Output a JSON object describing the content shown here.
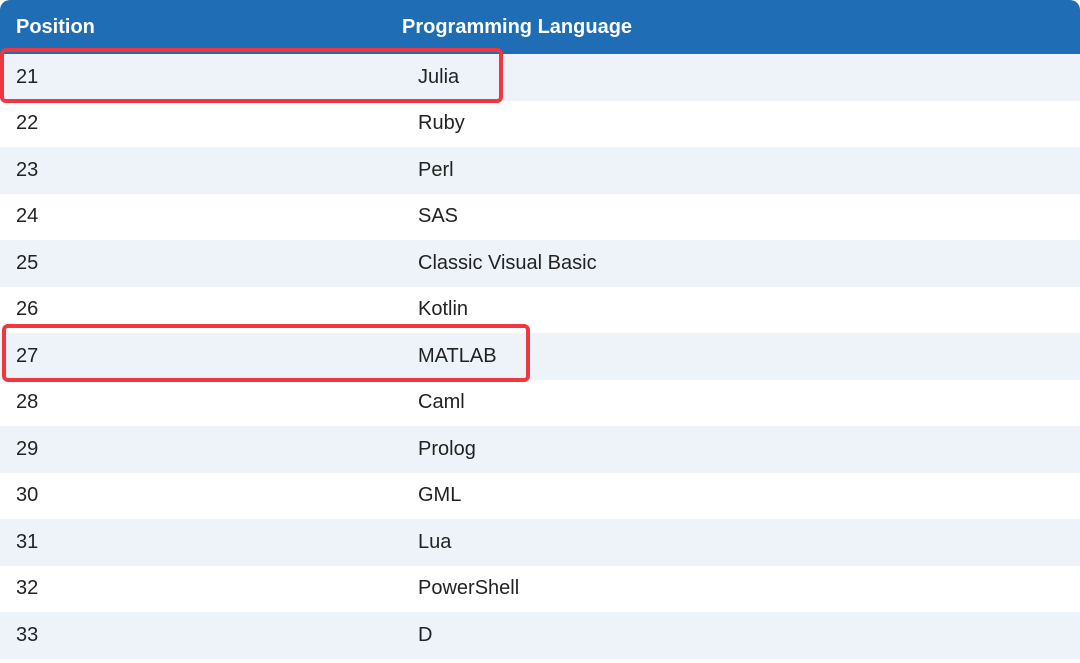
{
  "table": {
    "headers": {
      "position": "Position",
      "language": "Programming Language"
    },
    "rows": [
      {
        "position": "21",
        "language": "Julia"
      },
      {
        "position": "22",
        "language": "Ruby"
      },
      {
        "position": "23",
        "language": "Perl"
      },
      {
        "position": "24",
        "language": "SAS"
      },
      {
        "position": "25",
        "language": "Classic Visual Basic"
      },
      {
        "position": "26",
        "language": "Kotlin"
      },
      {
        "position": "27",
        "language": "MATLAB"
      },
      {
        "position": "28",
        "language": "Caml"
      },
      {
        "position": "29",
        "language": "Prolog"
      },
      {
        "position": "30",
        "language": "GML"
      },
      {
        "position": "31",
        "language": "Lua"
      },
      {
        "position": "32",
        "language": "PowerShell"
      },
      {
        "position": "33",
        "language": "D"
      }
    ]
  },
  "highlighted_rows": [
    "21",
    "27"
  ],
  "colors": {
    "header_background": "#1e6db5",
    "header_text": "#ffffff",
    "row_striped": "#eef3fa",
    "highlight_border": "#f0373f"
  }
}
